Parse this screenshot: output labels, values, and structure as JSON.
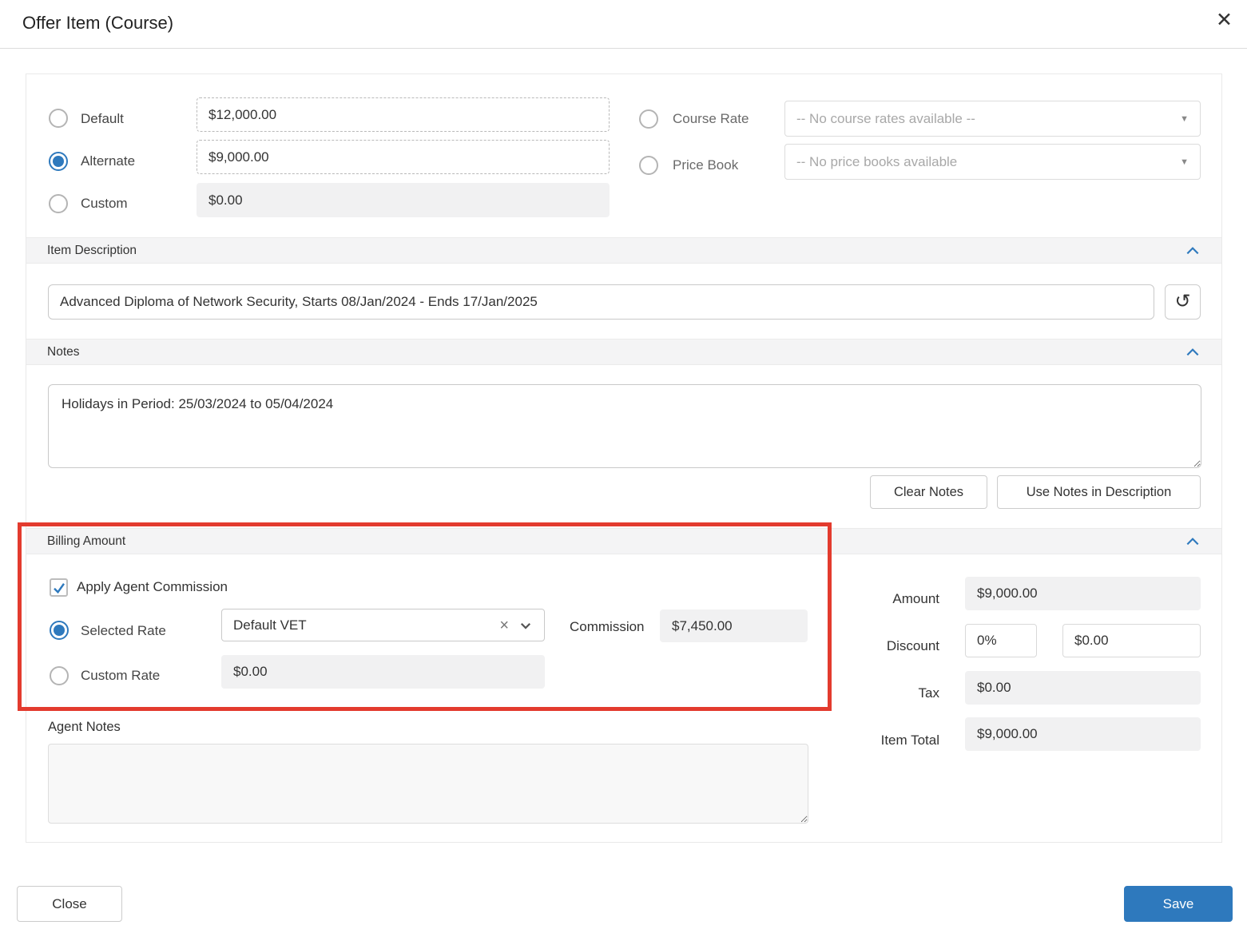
{
  "modal": {
    "title": "Offer Item (Course)"
  },
  "icons": {
    "close": "✕",
    "history": "↺",
    "clear": "×",
    "caret": "▼"
  },
  "pricing": {
    "options": [
      {
        "label": "Default",
        "value": "$12,000.00",
        "selected": false
      },
      {
        "label": "Alternate",
        "value": "$9,000.00",
        "selected": true
      },
      {
        "label": "Custom",
        "value": "$0.00",
        "selected": false
      }
    ],
    "course_rate": {
      "label": "Course Rate",
      "placeholder": "-- No course rates available --",
      "selected": false
    },
    "price_book": {
      "label": "Price Book",
      "placeholder": "-- No price books available",
      "selected": false
    }
  },
  "item_description": {
    "header": "Item Description",
    "value": "Advanced Diploma of Network Security, Starts 08/Jan/2024 - Ends 17/Jan/2025"
  },
  "notes": {
    "header": "Notes",
    "value": "Holidays in Period: 25/03/2024 to 05/04/2024",
    "clear_button": "Clear Notes",
    "use_button": "Use Notes in Description"
  },
  "billing": {
    "header": "Billing Amount",
    "apply_commission_label": "Apply Agent Commission",
    "apply_commission_checked": true,
    "selected_rate": {
      "label": "Selected Rate",
      "value": "Default VET",
      "selected": true
    },
    "commission": {
      "label": "Commission",
      "value": "$7,450.00"
    },
    "custom_rate": {
      "label": "Custom Rate",
      "value": "$0.00",
      "selected": false
    }
  },
  "totals": {
    "amount_label": "Amount",
    "amount": "$9,000.00",
    "discount_label": "Discount",
    "discount_percent": "0%",
    "discount_amount": "$0.00",
    "tax_label": "Tax",
    "tax": "$0.00",
    "item_total_label": "Item Total",
    "item_total": "$9,000.00"
  },
  "agent_notes": {
    "label": "Agent Notes",
    "value": ""
  },
  "footer": {
    "close": "Close",
    "save": "Save"
  },
  "colors": {
    "accent": "#2e79bd",
    "highlight": "#e33b2e"
  }
}
